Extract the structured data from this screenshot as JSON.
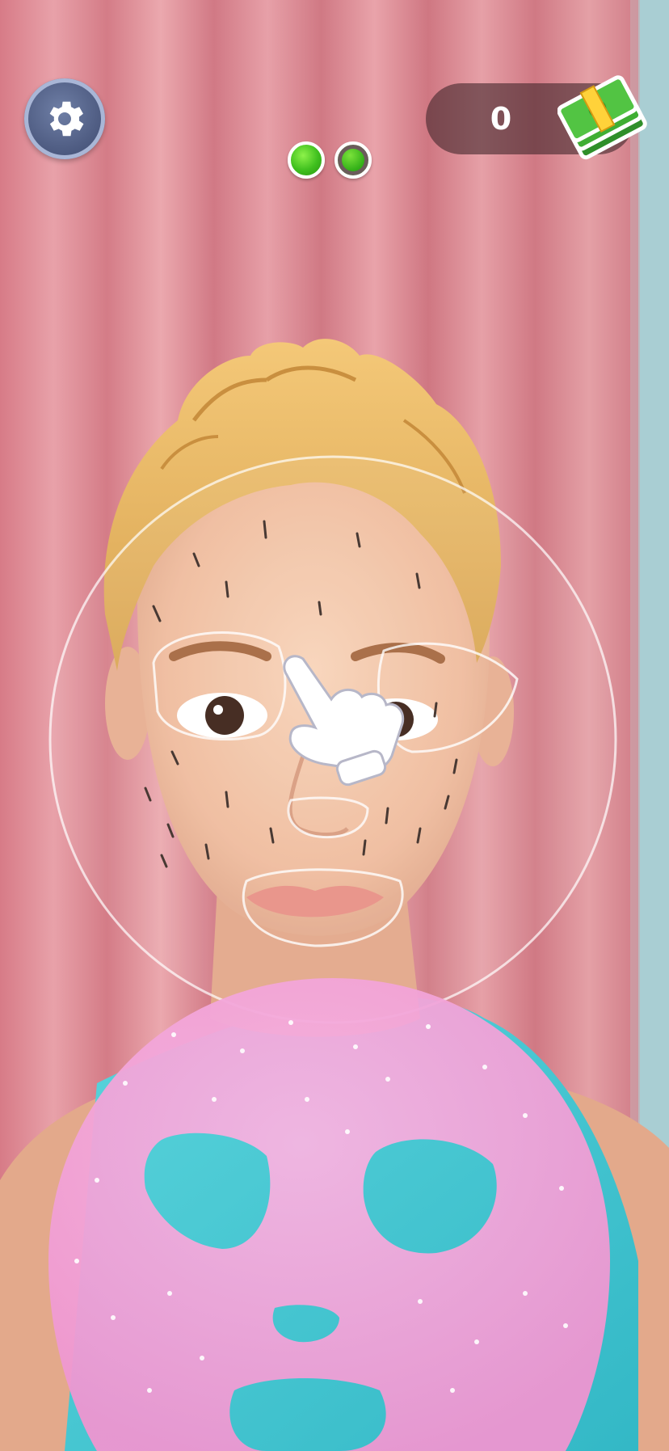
{
  "hud": {
    "settings_icon": "gear-icon",
    "stage_progress": {
      "total": 2,
      "completed": 2
    },
    "money": {
      "value": "0",
      "icon": "cash-stack-icon"
    }
  },
  "scene": {
    "character": "woman-with-blonde-hair",
    "tool": "pink-face-mask",
    "hint_icon": "pointing-hand-icon"
  },
  "colors": {
    "curtain": "#d98c95",
    "window": "#a9ced3",
    "hair": "#e8b760",
    "skin": "#f2c0a1",
    "mask": "#f4a6d8",
    "shirt": "#49c9d3",
    "dot_green": "#3fbf1e",
    "settings_blue": "#4a577d"
  }
}
